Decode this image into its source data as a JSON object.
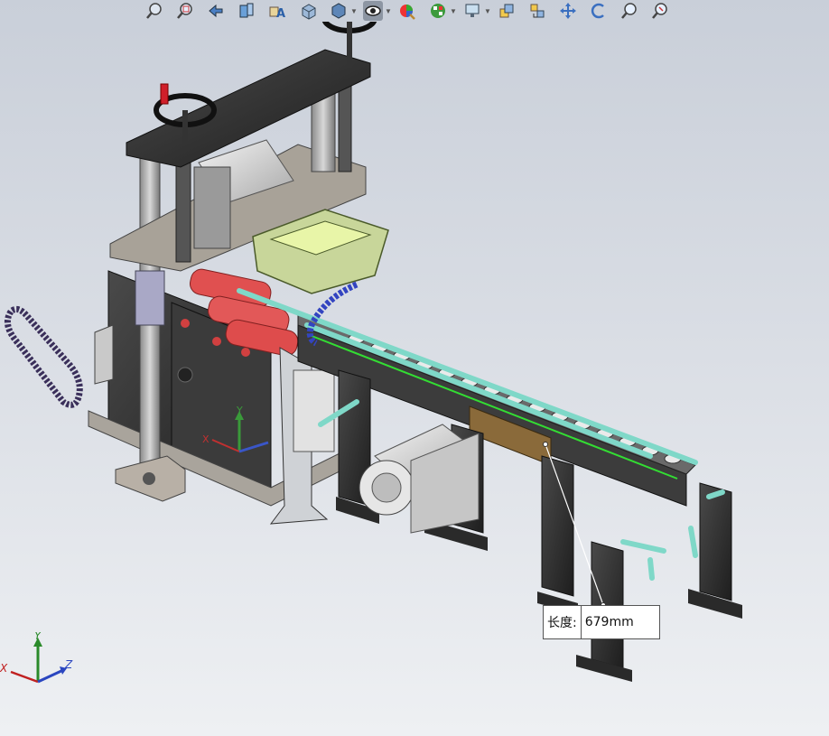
{
  "toolbar": {
    "items": [
      {
        "name": "zoom-to-fit-icon",
        "label": "Zoom to Fit"
      },
      {
        "name": "zoom-to-area-icon",
        "label": "Zoom to Area"
      },
      {
        "name": "previous-view-icon",
        "label": "Previous View"
      },
      {
        "name": "section-view-icon",
        "label": "Section View"
      },
      {
        "name": "dynamic-annotation-icon",
        "label": "Dynamic Annotation"
      },
      {
        "name": "view-orientation-icon",
        "label": "View Orientation"
      },
      {
        "name": "display-style-icon",
        "label": "Display Style"
      },
      {
        "name": "hide-show-items-icon",
        "label": "Hide/Show Items",
        "active": true
      },
      {
        "name": "edit-appearance-icon",
        "label": "Edit Appearance"
      },
      {
        "name": "apply-scene-icon",
        "label": "Apply Scene"
      },
      {
        "name": "view-settings-icon",
        "label": "View Settings"
      },
      {
        "name": "rotate-component-icon",
        "label": "Rotate"
      },
      {
        "name": "move-component-icon",
        "label": "Move"
      },
      {
        "name": "pan-icon",
        "label": "Pan"
      },
      {
        "name": "rotate-view-icon",
        "label": "Rotate View"
      },
      {
        "name": "zoom-in-out-icon",
        "label": "Zoom In/Out"
      },
      {
        "name": "zoom-to-selection-icon",
        "label": "Zoom to Selection"
      }
    ]
  },
  "measurement": {
    "label": "长度:",
    "value": "679mm"
  },
  "triad": {
    "x": "X",
    "y": "Y",
    "z": "Z"
  },
  "colors": {
    "accent_green": "#33dd33",
    "frame_dark": "#2e2e2e",
    "roller_red": "#e05050",
    "rail_cyan": "#7fd8c8",
    "plate_gray": "#8a8a8a"
  }
}
